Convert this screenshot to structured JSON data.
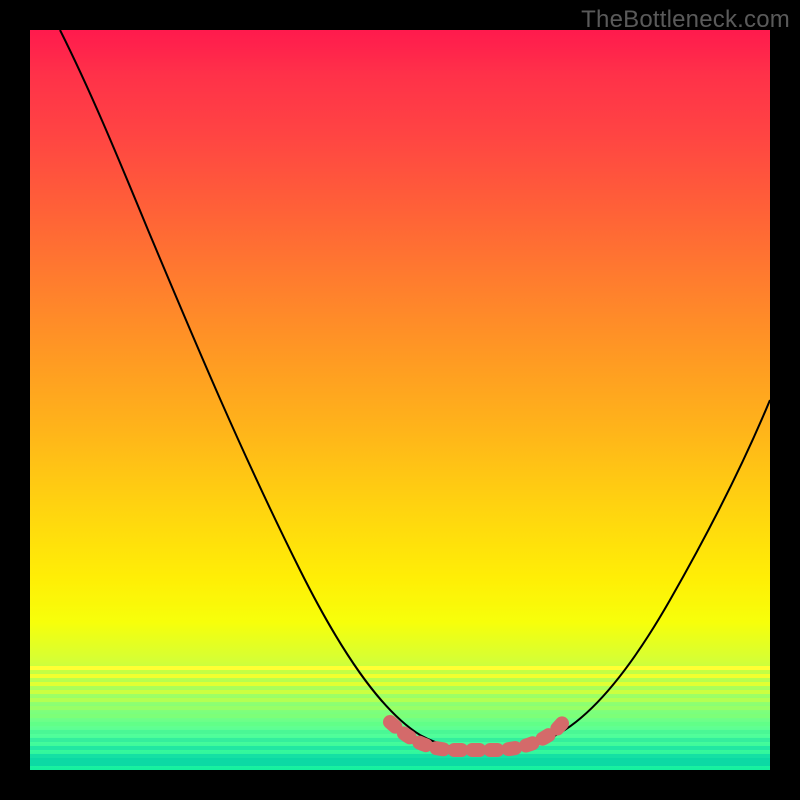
{
  "watermark": "TheBottleneck.com",
  "chart_data": {
    "type": "line",
    "title": "",
    "xlabel": "",
    "ylabel": "",
    "xlim": [
      0,
      100
    ],
    "ylim": [
      0,
      100
    ],
    "description": "Bottleneck curve over a vertical red-to-green gradient. The V-shaped curve reaches its minimum (optimal / green region) around x≈55–70, with a flat bottom highlighted by a dotted pink marker.",
    "background_gradient_stops": [
      {
        "pos": 0.0,
        "color": "#ff1a4d"
      },
      {
        "pos": 0.06,
        "color": "#ff3149"
      },
      {
        "pos": 0.14,
        "color": "#ff4443"
      },
      {
        "pos": 0.24,
        "color": "#ff6038"
      },
      {
        "pos": 0.34,
        "color": "#ff7d2e"
      },
      {
        "pos": 0.44,
        "color": "#ff9923"
      },
      {
        "pos": 0.54,
        "color": "#ffb41a"
      },
      {
        "pos": 0.64,
        "color": "#ffd210"
      },
      {
        "pos": 0.74,
        "color": "#ffee06"
      },
      {
        "pos": 0.8,
        "color": "#f7ff0a"
      },
      {
        "pos": 0.85,
        "color": "#d7ff33"
      },
      {
        "pos": 0.9,
        "color": "#9cff66"
      },
      {
        "pos": 0.95,
        "color": "#55ff99"
      },
      {
        "pos": 1.0,
        "color": "#14f0a0"
      }
    ],
    "series": [
      {
        "name": "bottleneck-curve",
        "x": [
          4,
          10,
          16,
          22,
          28,
          34,
          40,
          46,
          52,
          55,
          60,
          65,
          70,
          75,
          80,
          86,
          92,
          100
        ],
        "y": [
          100,
          89,
          78,
          67,
          56,
          46,
          35,
          24,
          12,
          6,
          3,
          3,
          4,
          9,
          18,
          30,
          42,
          58
        ]
      }
    ],
    "optimal_range": {
      "x_start": 52,
      "x_end": 72,
      "y": 3
    }
  }
}
